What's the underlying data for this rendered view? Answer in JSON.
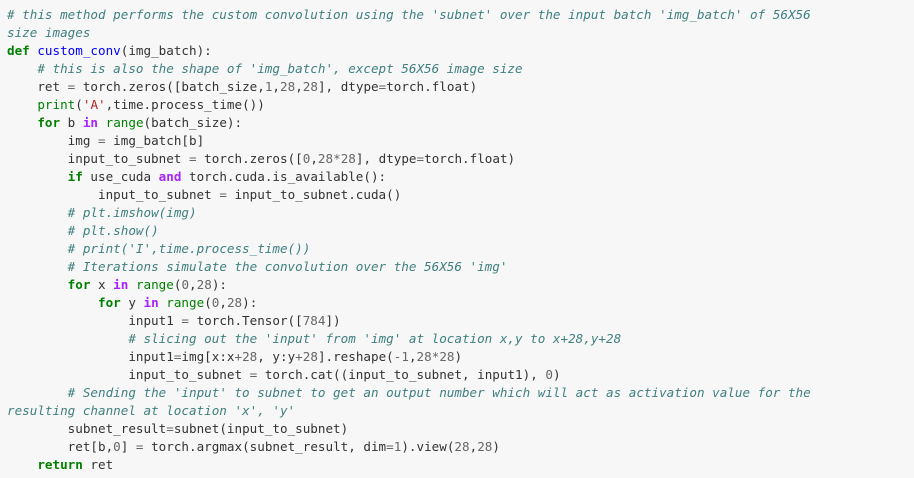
{
  "code_lines": [
    [
      {
        "t": "# this method performs the custom convolution using the 'subnet' over the input batch 'img_batch' of 56X56",
        "c": "c"
      }
    ],
    [
      {
        "t": "size images",
        "c": "c"
      }
    ],
    [
      {
        "t": "def",
        "c": "k"
      },
      {
        "t": " ",
        "c": "p"
      },
      {
        "t": "custom_conv",
        "c": "f"
      },
      {
        "t": "(img_batch):",
        "c": "p"
      }
    ],
    [
      {
        "t": "    ",
        "c": "p"
      },
      {
        "t": "# this is also the shape of 'img_batch', except 56X56 image size",
        "c": "c"
      }
    ],
    [
      {
        "t": "    ret ",
        "c": "p"
      },
      {
        "t": "=",
        "c": "n"
      },
      {
        "t": " torch.zeros([batch_size,",
        "c": "p"
      },
      {
        "t": "1",
        "c": "n"
      },
      {
        "t": ",",
        "c": "p"
      },
      {
        "t": "28",
        "c": "n"
      },
      {
        "t": ",",
        "c": "p"
      },
      {
        "t": "28",
        "c": "n"
      },
      {
        "t": "], dtype",
        "c": "p"
      },
      {
        "t": "=",
        "c": "n"
      },
      {
        "t": "torch.float)",
        "c": "p"
      }
    ],
    [
      {
        "t": "    ",
        "c": "p"
      },
      {
        "t": "print",
        "c": "b"
      },
      {
        "t": "(",
        "c": "p"
      },
      {
        "t": "'A'",
        "c": "s"
      },
      {
        "t": ",time.process_time())",
        "c": "p"
      }
    ],
    [
      {
        "t": "    ",
        "c": "p"
      },
      {
        "t": "for",
        "c": "k"
      },
      {
        "t": " b ",
        "c": "p"
      },
      {
        "t": "in",
        "c": "o"
      },
      {
        "t": " ",
        "c": "p"
      },
      {
        "t": "range",
        "c": "b"
      },
      {
        "t": "(batch_size):",
        "c": "p"
      }
    ],
    [
      {
        "t": "        img ",
        "c": "p"
      },
      {
        "t": "=",
        "c": "n"
      },
      {
        "t": " img_batch[b]",
        "c": "p"
      }
    ],
    [
      {
        "t": "        input_to_subnet ",
        "c": "p"
      },
      {
        "t": "=",
        "c": "n"
      },
      {
        "t": " torch.zeros([",
        "c": "p"
      },
      {
        "t": "0",
        "c": "n"
      },
      {
        "t": ",",
        "c": "p"
      },
      {
        "t": "28",
        "c": "n"
      },
      {
        "t": "*",
        "c": "n"
      },
      {
        "t": "28",
        "c": "n"
      },
      {
        "t": "], dtype",
        "c": "p"
      },
      {
        "t": "=",
        "c": "n"
      },
      {
        "t": "torch.float)",
        "c": "p"
      }
    ],
    [
      {
        "t": "        ",
        "c": "p"
      },
      {
        "t": "if",
        "c": "k"
      },
      {
        "t": " use_cuda ",
        "c": "p"
      },
      {
        "t": "and",
        "c": "o"
      },
      {
        "t": " torch.cuda.is_available():",
        "c": "p"
      }
    ],
    [
      {
        "t": "            input_to_subnet ",
        "c": "p"
      },
      {
        "t": "=",
        "c": "n"
      },
      {
        "t": " input_to_subnet.cuda()",
        "c": "p"
      }
    ],
    [
      {
        "t": "        ",
        "c": "p"
      },
      {
        "t": "# plt.imshow(img)",
        "c": "c"
      }
    ],
    [
      {
        "t": "        ",
        "c": "p"
      },
      {
        "t": "# plt.show()",
        "c": "c"
      }
    ],
    [
      {
        "t": "        ",
        "c": "p"
      },
      {
        "t": "# print('I',time.process_time())",
        "c": "c"
      }
    ],
    [
      {
        "t": "        ",
        "c": "p"
      },
      {
        "t": "# Iterations simulate the convolution over the 56X56 'img'",
        "c": "c"
      }
    ],
    [
      {
        "t": "        ",
        "c": "p"
      },
      {
        "t": "for",
        "c": "k"
      },
      {
        "t": " x ",
        "c": "p"
      },
      {
        "t": "in",
        "c": "o"
      },
      {
        "t": " ",
        "c": "p"
      },
      {
        "t": "range",
        "c": "b"
      },
      {
        "t": "(",
        "c": "p"
      },
      {
        "t": "0",
        "c": "n"
      },
      {
        "t": ",",
        "c": "p"
      },
      {
        "t": "28",
        "c": "n"
      },
      {
        "t": "):",
        "c": "p"
      }
    ],
    [
      {
        "t": "            ",
        "c": "p"
      },
      {
        "t": "for",
        "c": "k"
      },
      {
        "t": " y ",
        "c": "p"
      },
      {
        "t": "in",
        "c": "o"
      },
      {
        "t": " ",
        "c": "p"
      },
      {
        "t": "range",
        "c": "b"
      },
      {
        "t": "(",
        "c": "p"
      },
      {
        "t": "0",
        "c": "n"
      },
      {
        "t": ",",
        "c": "p"
      },
      {
        "t": "28",
        "c": "n"
      },
      {
        "t": "):",
        "c": "p"
      }
    ],
    [
      {
        "t": "                input1 ",
        "c": "p"
      },
      {
        "t": "=",
        "c": "n"
      },
      {
        "t": " torch.Tensor([",
        "c": "p"
      },
      {
        "t": "784",
        "c": "n"
      },
      {
        "t": "])",
        "c": "p"
      }
    ],
    [
      {
        "t": "                ",
        "c": "p"
      },
      {
        "t": "# slicing out the 'input' from 'img' at location x,y to x+28,y+28",
        "c": "c"
      }
    ],
    [
      {
        "t": "                input1",
        "c": "p"
      },
      {
        "t": "=",
        "c": "n"
      },
      {
        "t": "img[x:x",
        "c": "p"
      },
      {
        "t": "+",
        "c": "n"
      },
      {
        "t": "28",
        "c": "n"
      },
      {
        "t": ", y:y",
        "c": "p"
      },
      {
        "t": "+",
        "c": "n"
      },
      {
        "t": "28",
        "c": "n"
      },
      {
        "t": "].reshape(",
        "c": "p"
      },
      {
        "t": "-",
        "c": "n"
      },
      {
        "t": "1",
        "c": "n"
      },
      {
        "t": ",",
        "c": "p"
      },
      {
        "t": "28",
        "c": "n"
      },
      {
        "t": "*",
        "c": "n"
      },
      {
        "t": "28",
        "c": "n"
      },
      {
        "t": ")",
        "c": "p"
      }
    ],
    [
      {
        "t": "                input_to_subnet ",
        "c": "p"
      },
      {
        "t": "=",
        "c": "n"
      },
      {
        "t": " torch.cat((input_to_subnet, input1), ",
        "c": "p"
      },
      {
        "t": "0",
        "c": "n"
      },
      {
        "t": ")",
        "c": "p"
      }
    ],
    [
      {
        "t": "        ",
        "c": "p"
      },
      {
        "t": "# Sending the 'input' to subnet to get an output number which will act as activation value for the",
        "c": "c"
      }
    ],
    [
      {
        "t": "resulting channel at location 'x', 'y'",
        "c": "c"
      }
    ],
    [
      {
        "t": "        subnet_result",
        "c": "p"
      },
      {
        "t": "=",
        "c": "n"
      },
      {
        "t": "subnet(input_to_subnet)",
        "c": "p"
      }
    ],
    [
      {
        "t": "        ret[b,",
        "c": "p"
      },
      {
        "t": "0",
        "c": "n"
      },
      {
        "t": "] ",
        "c": "p"
      },
      {
        "t": "=",
        "c": "n"
      },
      {
        "t": " torch.argmax(subnet_result, dim",
        "c": "p"
      },
      {
        "t": "=",
        "c": "n"
      },
      {
        "t": "1",
        "c": "n"
      },
      {
        "t": ").view(",
        "c": "p"
      },
      {
        "t": "28",
        "c": "n"
      },
      {
        "t": ",",
        "c": "p"
      },
      {
        "t": "28",
        "c": "n"
      },
      {
        "t": ")",
        "c": "p"
      }
    ],
    [
      {
        "t": "    ",
        "c": "p"
      },
      {
        "t": "return",
        "c": "k"
      },
      {
        "t": " ret",
        "c": "p"
      }
    ]
  ],
  "colors": {
    "background": "#f7f7f7",
    "text": "#333333",
    "comment": "#408080",
    "keyword": "#008000",
    "operator_word": "#aa22ff",
    "builtin": "#008000",
    "function_name": "#0000ff",
    "string": "#ba2121",
    "number": "#666666"
  }
}
